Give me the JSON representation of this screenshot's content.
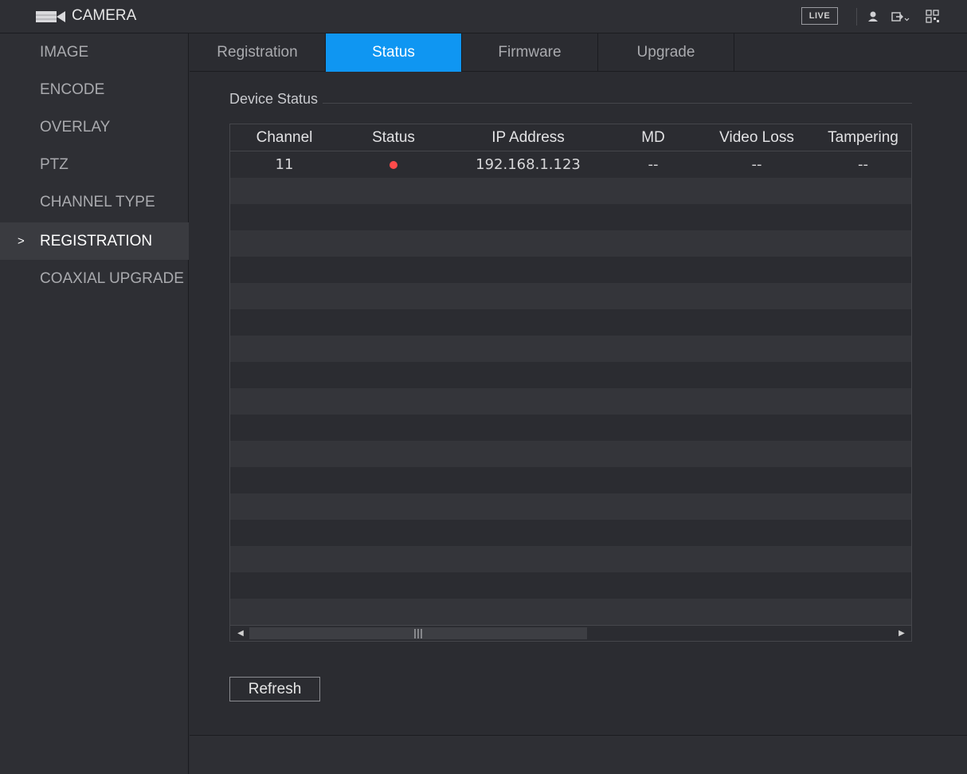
{
  "app": {
    "title": "CAMERA",
    "live_label": "LIVE"
  },
  "icons": {
    "camera": "camera-icon",
    "user": "user-icon",
    "logout": "logout-icon",
    "qr": "qr-code-icon"
  },
  "sidebar": {
    "items": [
      {
        "label": "IMAGE"
      },
      {
        "label": "ENCODE"
      },
      {
        "label": "OVERLAY"
      },
      {
        "label": "PTZ"
      },
      {
        "label": "CHANNEL TYPE"
      },
      {
        "label": "REGISTRATION",
        "active": true,
        "chevron": ">"
      },
      {
        "label": "COAXIAL UPGRADE"
      }
    ]
  },
  "tabs": [
    {
      "label": "Registration"
    },
    {
      "label": "Status",
      "active": true
    },
    {
      "label": "Firmware"
    },
    {
      "label": "Upgrade"
    }
  ],
  "device_status": {
    "title": "Device Status",
    "columns": [
      "Channel",
      "Status",
      "IP Address",
      "MD",
      "Video Loss",
      "Tampering"
    ],
    "rows": [
      {
        "channel": "11",
        "status": "offline",
        "ip": "192.168.1.123",
        "md": "--",
        "video_loss": "--",
        "tampering": "--"
      }
    ]
  },
  "refresh_label": "Refresh",
  "colors": {
    "accent": "#0f96f2",
    "status_dot": "#ff4b4b",
    "background": "#2b2c31"
  }
}
